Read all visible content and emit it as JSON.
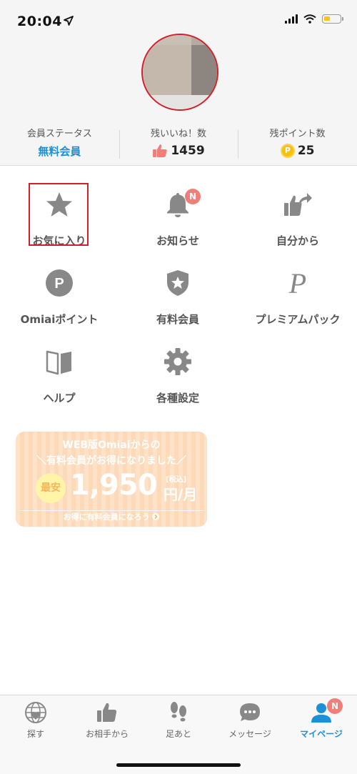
{
  "status_bar": {
    "time": "20:04"
  },
  "profile": {
    "stats": [
      {
        "label": "会員ステータス",
        "value": "無料会員"
      },
      {
        "label": "残いいね！数",
        "value": "1459"
      },
      {
        "label": "残ポイント数",
        "value": "25",
        "coin_glyph": "P"
      }
    ]
  },
  "menu": {
    "items": [
      {
        "label": "お気に入り",
        "icon": "star-icon"
      },
      {
        "label": "お知らせ",
        "icon": "bell-icon",
        "badge": "N"
      },
      {
        "label": "自分から",
        "icon": "like-share-icon"
      },
      {
        "label": "Omiaiポイント",
        "icon": "point-icon",
        "glyph": "P"
      },
      {
        "label": "有料会員",
        "icon": "shield-star-icon"
      },
      {
        "label": "プレミアムパック",
        "icon": "premium-p-icon",
        "glyph": "P"
      },
      {
        "label": "ヘルプ",
        "icon": "book-icon"
      },
      {
        "label": "各種設定",
        "icon": "gear-icon"
      }
    ]
  },
  "banner": {
    "line1": "WEB版Omiaiからの",
    "line2": "＼有料会員がお得になりました／",
    "circle": "最安",
    "price": "1,950",
    "tax": "[税込]",
    "unit": "円/月",
    "footer": "お得に有料会員になろう"
  },
  "tab_bar": {
    "tabs": [
      {
        "label": "探す",
        "icon": "globe-heart-icon"
      },
      {
        "label": "お相手から",
        "icon": "thumbs-up-icon"
      },
      {
        "label": "足あと",
        "icon": "footprints-icon"
      },
      {
        "label": "メッセージ",
        "icon": "chat-bubble-icon"
      },
      {
        "label": "マイページ",
        "icon": "person-icon",
        "badge": "N",
        "active": true
      }
    ]
  },
  "colors": {
    "accent": "#1e90d6",
    "badge": "#f07f7a",
    "icon": "#888888",
    "highlight": "#d21f2a",
    "coin": "#f4c20d"
  }
}
